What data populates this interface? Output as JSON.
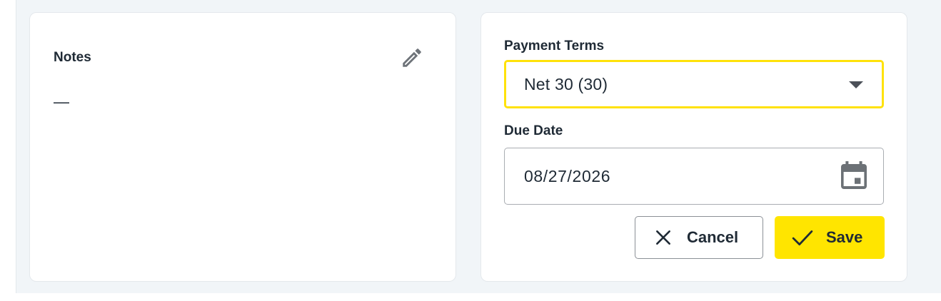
{
  "notes": {
    "title": "Notes",
    "value": "—",
    "edit_icon": "pencil-icon"
  },
  "payment": {
    "terms_label": "Payment Terms",
    "terms_value": "Net 30 (30)",
    "terms_icon": "caret-down-icon",
    "due_date_label": "Due Date",
    "due_date_value": "08/27/2026",
    "due_date_icon": "calendar-icon"
  },
  "actions": {
    "cancel_label": "Cancel",
    "cancel_icon": "close-icon",
    "save_label": "Save",
    "save_icon": "check-icon"
  },
  "colors": {
    "accent": "#FFE500",
    "page_background": "#F1F5F8",
    "text": "#1F2A35"
  }
}
